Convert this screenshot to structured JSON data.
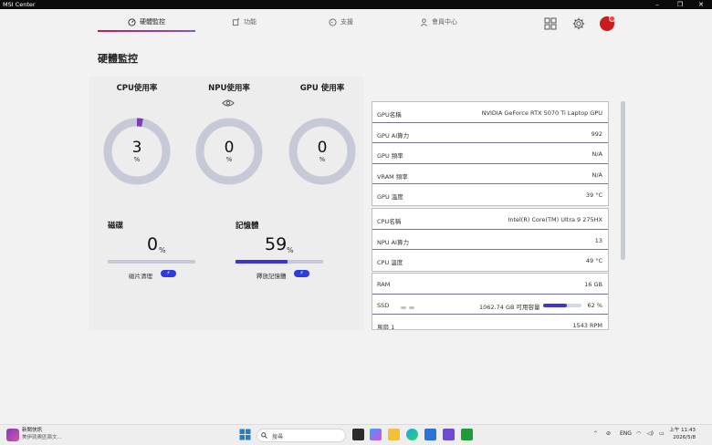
{
  "window": {
    "title": "MSI Center",
    "minimize": "–",
    "maximize": "❐",
    "close": "✕"
  },
  "nav": {
    "tabs": [
      {
        "label": "硬體監控",
        "icon": "gauge-icon"
      },
      {
        "label": "功能",
        "icon": "feature-icon"
      },
      {
        "label": "支援",
        "icon": "support-icon"
      },
      {
        "label": "會員中心",
        "icon": "member-icon"
      }
    ],
    "right_icons": [
      "grid-icon",
      "gear-icon",
      "avatar"
    ]
  },
  "page_title": "硬體監控",
  "gauges": [
    {
      "title": "CPU使用率",
      "value": "3",
      "unit": "%",
      "fraction": 0.03,
      "accent": "#7b3fb0"
    },
    {
      "title": "NPU使用率",
      "value": "0",
      "unit": "%",
      "fraction": 0
    },
    {
      "title": "GPU 使用率",
      "value": "0",
      "unit": "%",
      "fraction": 0
    }
  ],
  "disk": {
    "title": "磁碟",
    "value": "0",
    "unit": "%",
    "fraction": 0,
    "action": "磁片清理",
    "action_icon": "⚡"
  },
  "memory": {
    "title": "記憶體",
    "value": "59",
    "unit": "%",
    "fraction": 0.59,
    "action": "釋放記憶體",
    "action_icon": "⚡"
  },
  "gpu_info": [
    {
      "label": "GPU名稱",
      "value": "NVIDIA GeForce RTX 5070 Ti Laptop GPU"
    },
    {
      "label": "GPU AI算力",
      "value": "992"
    },
    {
      "label": "GPU 頻率",
      "value": "N/A"
    },
    {
      "label": "VRAM 頻率",
      "value": "N/A"
    },
    {
      "label": "GPU 溫度",
      "value": "39 °C"
    }
  ],
  "cpu_info": [
    {
      "label": "CPU名稱",
      "value": "Intel(R) Core(TM) Ultra 9 275HX"
    },
    {
      "label": "NPU AI算力",
      "value": "13"
    },
    {
      "label": "CPU 溫度",
      "value": "49 °C"
    }
  ],
  "sys_info": {
    "ram_label": "RAM",
    "ram_value": "16 GB",
    "ssd_label": "SSD",
    "ssd_free": "1062.74 GB 可用容量",
    "ssd_percent": "62 %",
    "ssd_fraction": 0.62,
    "fan_label": "風扇 1",
    "fan_value": "1543 RPM"
  },
  "taskbar": {
    "news_title": "新聞快訊",
    "news_sub": "美伊就奧區兩文...",
    "search_placeholder": "搜尋",
    "lang": "ENG",
    "time": "上午 11:43",
    "date": "2026/5/8"
  },
  "colors": {
    "accent": "#3a36d6",
    "ring": "#c6cad6",
    "cpu_arc": "#7b3fb0"
  }
}
